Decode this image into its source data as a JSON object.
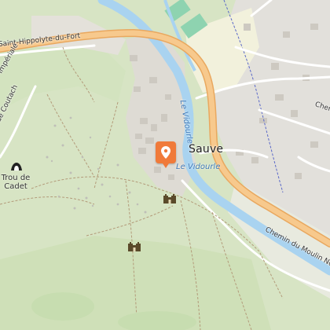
{
  "map": {
    "place_labels": {
      "town": "Sauve",
      "poi_trou": "Trou de\nCadet"
    },
    "water_labels": {
      "river_vertical": "Le Vidourle",
      "river_horizontal": "Le Vidourle"
    },
    "road_labels": {
      "road_nw": "Saint-Hippolyte-du-Fort",
      "road_se": "Chemin du Moulin Neuf",
      "road_ne": "Chemi",
      "road_w_1": "de Coutach",
      "road_w_2": "Impériale"
    },
    "icons": {
      "marker": "location-pin-icon",
      "castle_1": "castle-ruin-icon",
      "castle_2": "castle-ruin-icon",
      "cave": "cave-icon"
    },
    "colors": {
      "forest": "#d7e4c4",
      "urban": "#e2e0db",
      "water": "#a9d3f0",
      "main_road": "#f7c98d",
      "sports": "#8ed3b0",
      "marker": "#f07a3a"
    }
  }
}
